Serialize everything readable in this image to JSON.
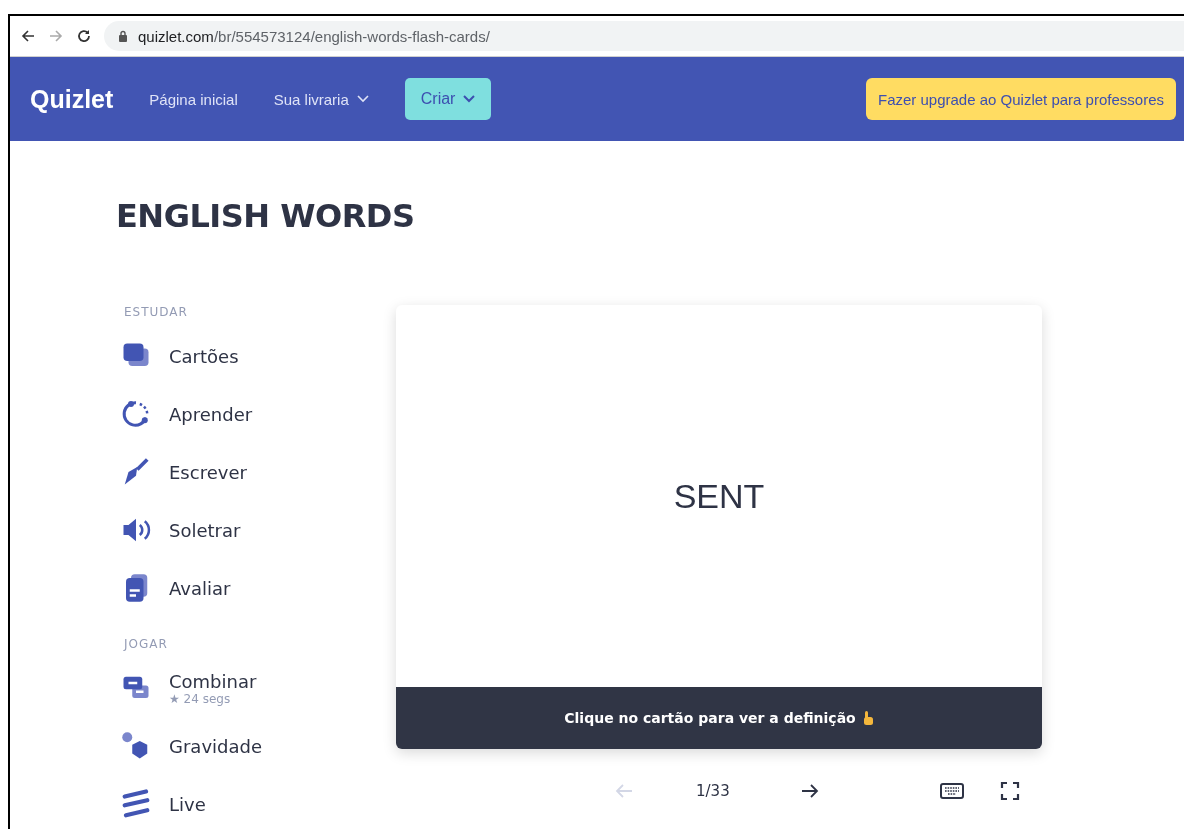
{
  "browser": {
    "url_host": "quizlet.com",
    "url_path": "/br/554573124/english-words-flash-cards/",
    "forward_disabled": true
  },
  "nav": {
    "logo": "Quizlet",
    "links": [
      "Página inicial",
      "Sua livraria"
    ],
    "create": "Criar",
    "upgrade": "Fazer upgrade ao Quizlet para professores"
  },
  "title": "ENGLISH WORDS",
  "sections": [
    {
      "heading": "ESTUDAR",
      "items": [
        {
          "label": "Cartões"
        },
        {
          "label": "Aprender"
        },
        {
          "label": "Escrever"
        },
        {
          "label": "Soletrar"
        },
        {
          "label": "Avaliar"
        }
      ]
    },
    {
      "heading": "JOGAR",
      "items": [
        {
          "label": "Combinar",
          "sub": "★ 24 segs"
        },
        {
          "label": "Gravidade"
        },
        {
          "label": "Live"
        }
      ]
    }
  ],
  "card": {
    "term": "SENT",
    "hint": "Clique no cartão para ver a definição"
  },
  "controls": {
    "prev_disabled": true,
    "counter": "1/33"
  }
}
